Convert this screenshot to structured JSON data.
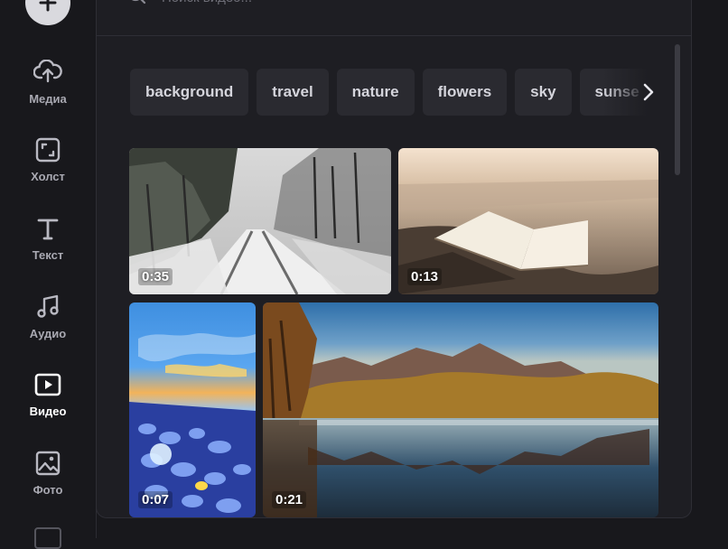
{
  "sidebar": {
    "add_icon": "plus-icon",
    "items": [
      {
        "label": "Медиа",
        "icon": "cloud-upload-icon"
      },
      {
        "label": "Холст",
        "icon": "canvas-frame-icon"
      },
      {
        "label": "Текст",
        "icon": "text-t-icon"
      },
      {
        "label": "Аудио",
        "icon": "music-note-icon"
      },
      {
        "label": "Видео",
        "icon": "video-play-icon",
        "active": true
      },
      {
        "label": "Фото",
        "icon": "image-icon"
      }
    ]
  },
  "search": {
    "placeholder": "Поиск видео..."
  },
  "tags": [
    "background",
    "travel",
    "nature",
    "flowers",
    "sky",
    "sunse"
  ],
  "videos": [
    {
      "duration": "0:35",
      "subject": "snowy forest road"
    },
    {
      "duration": "0:13",
      "subject": "open book on sand"
    },
    {
      "duration": "0:07",
      "subject": "sea glass beach at sunset"
    },
    {
      "duration": "0:21",
      "subject": "mountain lake autumn reflection"
    }
  ],
  "colors": {
    "background": "#18181c",
    "panel": "#1e1e23",
    "chip": "#2a2a30",
    "active_text": "#ffffff",
    "muted_text": "#a9a9b2"
  }
}
